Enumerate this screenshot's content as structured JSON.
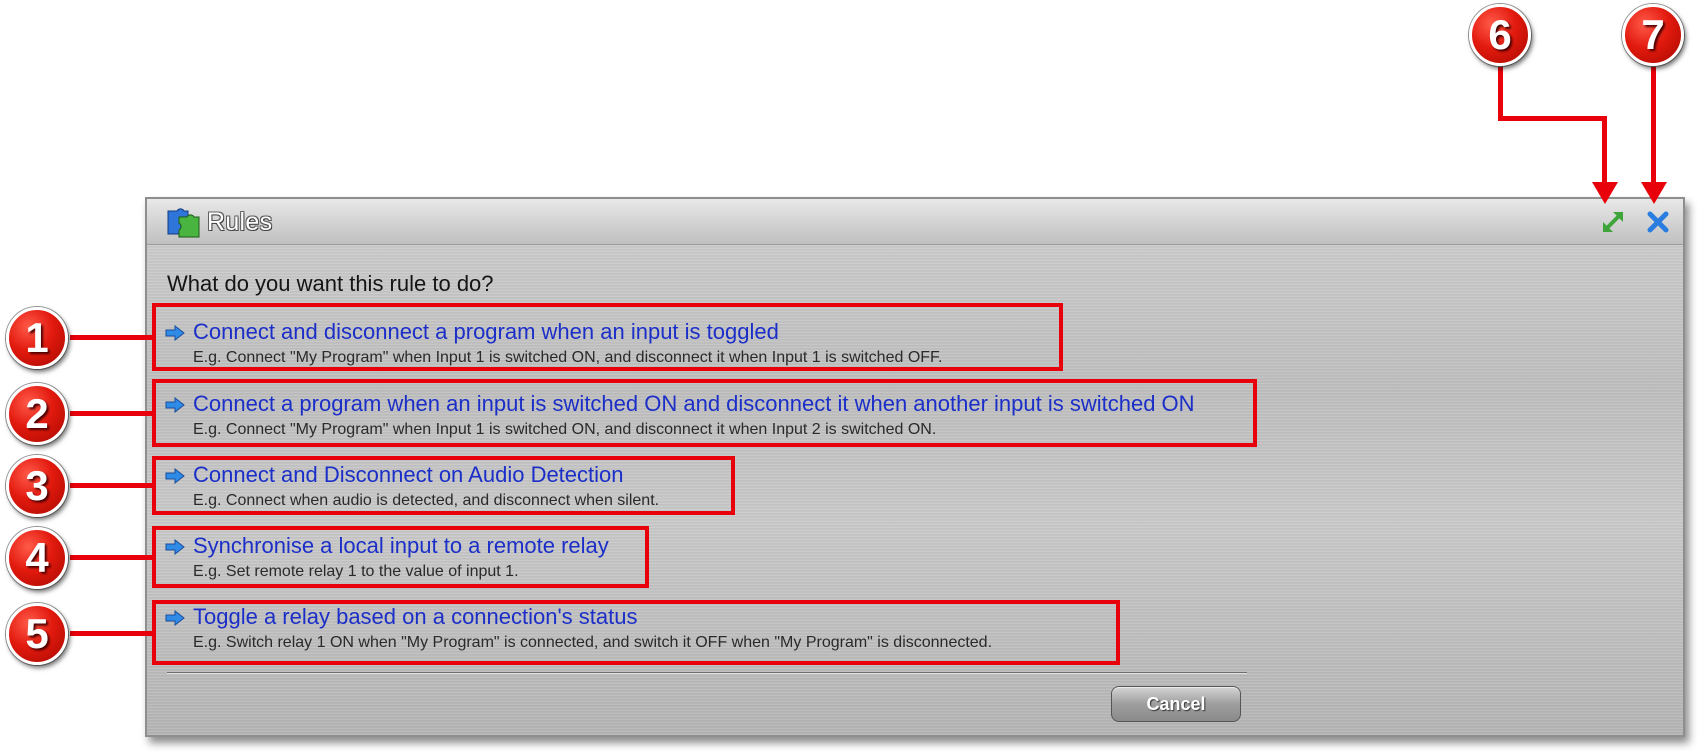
{
  "dialog": {
    "title": "Rules",
    "question": "What do you want this rule to do?",
    "title_icon": "puzzle-pieces-icon",
    "expand_icon": "expand-icon",
    "close_icon": "close-icon",
    "cancel_label": "Cancel"
  },
  "options": [
    {
      "title": "Connect and disconnect a program when an input is toggled",
      "description": "E.g. Connect \"My Program\" when Input 1 is switched ON, and disconnect it when Input 1 is switched OFF."
    },
    {
      "title": "Connect a program when an input is switched ON and disconnect it when another input is switched ON",
      "description": "E.g. Connect \"My Program\" when Input 1 is switched ON, and disconnect it when Input 2 is switched ON."
    },
    {
      "title": "Connect and Disconnect on Audio Detection",
      "description": "E.g. Connect when audio is detected, and disconnect when silent."
    },
    {
      "title": "Synchronise a local input to a remote relay",
      "description": "E.g. Set remote relay 1 to the value of input 1."
    },
    {
      "title": "Toggle a relay based on a connection's status",
      "description": "E.g. Switch relay 1 ON when \"My Program\" is connected, and switch it OFF when \"My Program\" is disconnected."
    }
  ],
  "callouts": [
    "1",
    "2",
    "3",
    "4",
    "5",
    "6",
    "7"
  ],
  "colors": {
    "annotation_red": "#e8000b",
    "link_blue": "#1b2fc8",
    "accent_blue": "#2a7de0",
    "expand_green": "#3fa53a"
  }
}
